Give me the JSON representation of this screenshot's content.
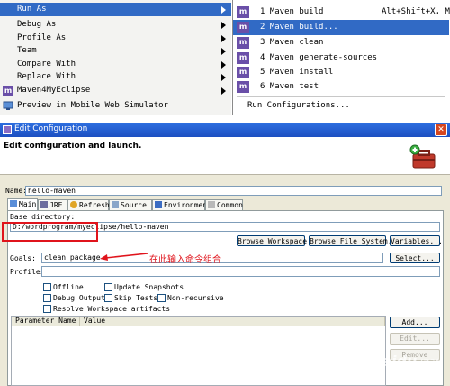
{
  "context_menu": {
    "items": [
      {
        "label": "Run As",
        "icon": "",
        "submenu": true,
        "selected": true
      },
      {
        "label": "Debug As",
        "icon": "",
        "submenu": true
      },
      {
        "label": "Profile As",
        "icon": "",
        "submenu": true
      },
      {
        "label": "Team",
        "icon": "",
        "submenu": true
      },
      {
        "label": "Compare With",
        "icon": "",
        "submenu": true
      },
      {
        "label": "Replace With",
        "icon": "",
        "submenu": true
      },
      {
        "label": "Maven4MyEclipse",
        "icon": "maven-m-icon",
        "submenu": true
      },
      {
        "label": "Preview in Mobile Web Simulator",
        "icon": "mobile-simulator-icon",
        "submenu": false
      }
    ]
  },
  "run_as_submenu": {
    "items": [
      {
        "label": "1 Maven build",
        "shortcut": "Alt+Shift+X, M",
        "icon": "maven-m-icon"
      },
      {
        "label": "2 Maven build...",
        "shortcut": "",
        "icon": "maven-m-icon",
        "selected": true
      },
      {
        "label": "3 Maven clean",
        "shortcut": "",
        "icon": "maven-m-icon"
      },
      {
        "label": "4 Maven generate-sources",
        "shortcut": "",
        "icon": "maven-m-icon"
      },
      {
        "label": "5 Maven install",
        "shortcut": "",
        "icon": "maven-m-icon"
      },
      {
        "label": "6 Maven test",
        "shortcut": "",
        "icon": "maven-m-icon"
      }
    ],
    "run_configurations": "Run Configurations..."
  },
  "icon_letter": "m",
  "dialog": {
    "title": "Edit Configuration",
    "close_glyph": "✕",
    "header": "Edit configuration and launch.",
    "name_label": "Name:",
    "name_value": "hello-maven",
    "tabs": [
      {
        "label": "Main",
        "icon": "main-tab-icon",
        "active": true
      },
      {
        "label": "JRE",
        "icon": "jre-tab-icon"
      },
      {
        "label": "Refresh",
        "icon": "refresh-tab-icon"
      },
      {
        "label": "Source",
        "icon": "source-tab-icon"
      },
      {
        "label": "Environment",
        "icon": "environment-tab-icon"
      },
      {
        "label": "Common",
        "icon": "common-tab-icon"
      }
    ],
    "base_directory_label": "Base directory:",
    "base_directory_value": "D:/wordprogram/myeclipse/hello-maven",
    "browse_workspace": "Browse Workspace...",
    "browse_file_system": "Browse File System...",
    "variables": "Variables...",
    "goals_label": "Goals:",
    "goals_value": "clean package",
    "select_button": "Select...",
    "profiles_label": "Profiles:",
    "profiles_value": "",
    "checkboxes": [
      {
        "label": "Offline",
        "checked": false
      },
      {
        "label": "Update Snapshots",
        "checked": false
      },
      {
        "label": "Debug Output",
        "checked": false
      },
      {
        "label": "Skip Tests",
        "checked": false
      },
      {
        "label": "Non-recursive",
        "checked": false
      },
      {
        "label": "Resolve Workspace artifacts",
        "checked": false
      }
    ],
    "table_headers": [
      "Parameter Name",
      "Value"
    ],
    "add_button": "Add...",
    "edit_button": "Edit...",
    "remove_button": "Remove"
  },
  "annotation": {
    "text": "在此输入命令组合",
    "color": "#e0141c"
  },
  "watermark": {
    "brand": "Baidu",
    "suffix": "经验"
  }
}
